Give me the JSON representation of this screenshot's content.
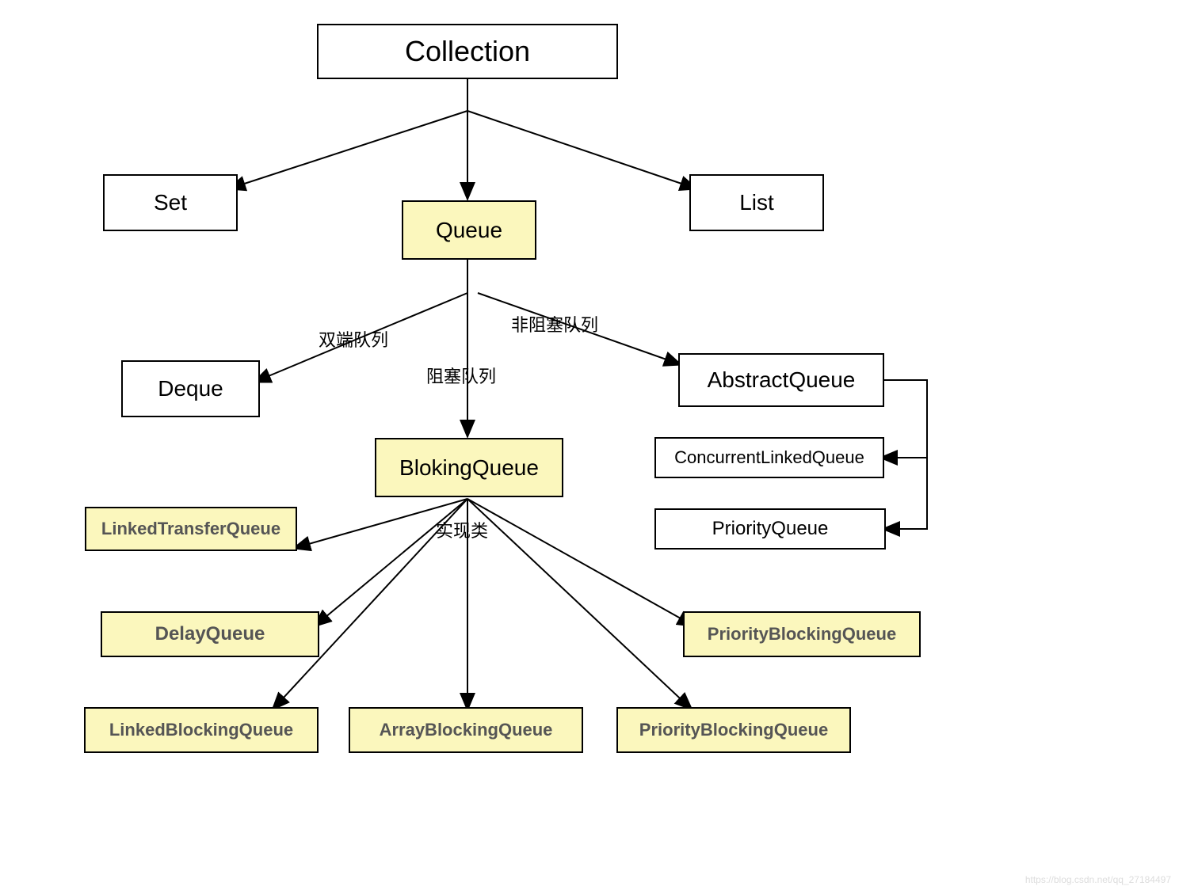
{
  "nodes": {
    "collection": "Collection",
    "set": "Set",
    "queue": "Queue",
    "list": "List",
    "deque": "Deque",
    "blockingQueue": "BlokingQueue",
    "abstractQueue": "AbstractQueue",
    "concurrentLinkedQueue": "ConcurrentLinkedQueue",
    "priorityQueue": "PriorityQueue",
    "linkedTransferQueue": "LinkedTransferQueue",
    "delayQueue": "DelayQueue",
    "linkedBlockingQueue": "LinkedBlockingQueue",
    "arrayBlockingQueue": "ArrayBlockingQueue",
    "priorityBlockingQueue1": "PriorityBlockingQueue",
    "priorityBlockingQueue2": "PriorityBlockingQueue"
  },
  "edgeLabels": {
    "deque": "双端队列",
    "blocking": "阻塞队列",
    "nonBlocking": "非阻塞队列",
    "impl": "实现类"
  },
  "watermark": "https://blog.csdn.net/qq_27184497"
}
